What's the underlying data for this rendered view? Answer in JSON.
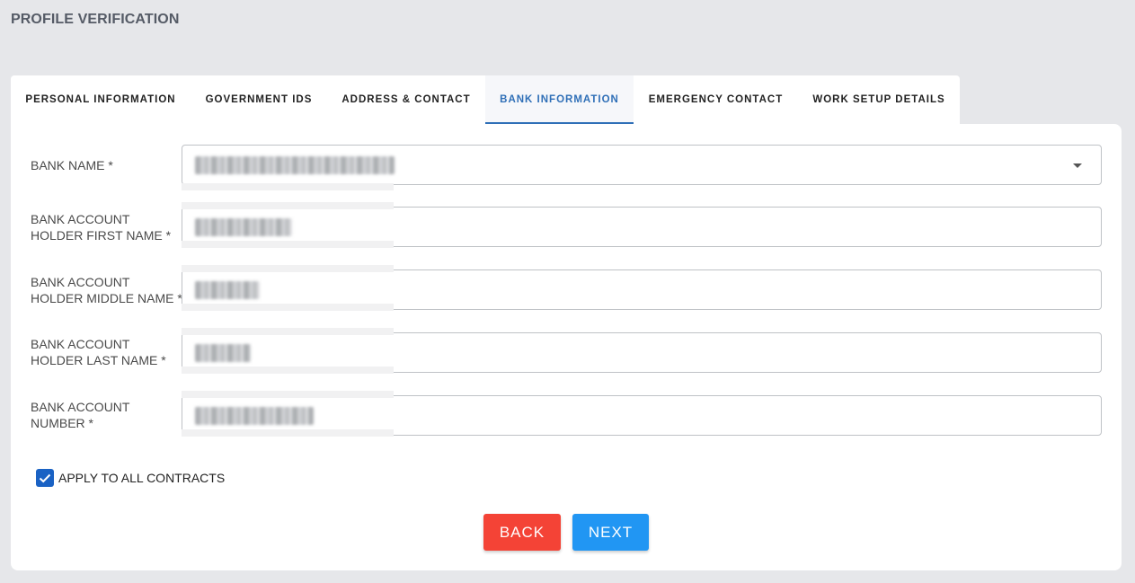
{
  "page_title": "PROFILE VERIFICATION",
  "tabs": [
    {
      "label": "PERSONAL INFORMATION",
      "active": false
    },
    {
      "label": "GOVERNMENT IDS",
      "active": false
    },
    {
      "label": "ADDRESS & CONTACT",
      "active": false
    },
    {
      "label": "BANK INFORMATION",
      "active": true
    },
    {
      "label": "EMERGENCY CONTACT",
      "active": false
    },
    {
      "label": "WORK SETUP DETAILS",
      "active": false
    }
  ],
  "form": {
    "bank_name": {
      "label": "BANK NAME *",
      "value": "",
      "type": "select"
    },
    "first_name": {
      "label_line1": "BANK ACCOUNT",
      "label_line2": "HOLDER FIRST NAME *",
      "value": ""
    },
    "middle_name": {
      "label_line1": "BANK ACCOUNT",
      "label_line2": "HOLDER MIDDLE NAME *",
      "value": ""
    },
    "last_name": {
      "label_line1": "BANK ACCOUNT",
      "label_line2": "HOLDER LAST NAME *",
      "value": ""
    },
    "account_number": {
      "label_line1": "BANK ACCOUNT",
      "label_line2": "NUMBER *",
      "value": ""
    }
  },
  "apply_all": {
    "label": "APPLY TO ALL CONTRACTS",
    "checked": true
  },
  "buttons": {
    "back": "BACK",
    "next": "NEXT"
  },
  "colors": {
    "accent": "#2f6fb7",
    "back": "#f44336",
    "next": "#2196f3",
    "checkbox": "#1a62c4"
  }
}
